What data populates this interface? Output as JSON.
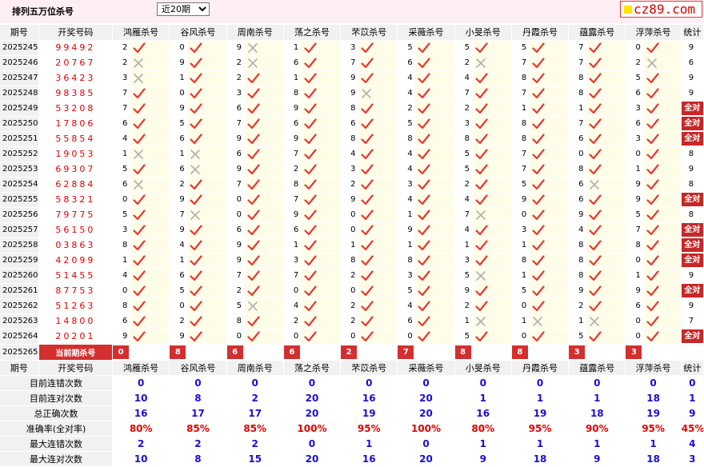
{
  "topbar": {
    "title": "排列五万位杀号",
    "period_select": "近20期",
    "logo": "cz89.com"
  },
  "columns": [
    "期号",
    "开奖号码",
    "鸿雁杀号",
    "谷风杀号",
    "周南杀号",
    "荡之杀号",
    "芣苡杀号",
    "采薇杀号",
    "小旻杀号",
    "丹霞杀号",
    "蕴露杀号",
    "浮萍杀号",
    "统计"
  ],
  "full_label": "全对",
  "rows": [
    {
      "issue": "2025245",
      "numbers": "99492",
      "kills": [
        2,
        0,
        9,
        1,
        3,
        5,
        5,
        5,
        7,
        0
      ],
      "marks": [
        "R",
        "R",
        "W",
        "R",
        "R",
        "R",
        "R",
        "R",
        "R",
        "R"
      ],
      "total": "9"
    },
    {
      "issue": "2025246",
      "numbers": "20767",
      "kills": [
        2,
        9,
        2,
        6,
        7,
        6,
        2,
        7,
        7,
        2
      ],
      "marks": [
        "W",
        "R",
        "W",
        "R",
        "R",
        "R",
        "W",
        "R",
        "R",
        "W"
      ],
      "total": "6"
    },
    {
      "issue": "2025247",
      "numbers": "36423",
      "kills": [
        3,
        1,
        2,
        1,
        9,
        4,
        4,
        8,
        8,
        5
      ],
      "marks": [
        "W",
        "R",
        "R",
        "R",
        "R",
        "R",
        "R",
        "R",
        "R",
        "R"
      ],
      "total": "9"
    },
    {
      "issue": "2025248",
      "numbers": "98385",
      "kills": [
        7,
        0,
        3,
        8,
        9,
        4,
        7,
        7,
        8,
        6
      ],
      "marks": [
        "R",
        "R",
        "R",
        "R",
        "W",
        "R",
        "R",
        "R",
        "R",
        "R"
      ],
      "total": "9"
    },
    {
      "issue": "2025249",
      "numbers": "53208",
      "kills": [
        7,
        9,
        6,
        9,
        8,
        2,
        2,
        1,
        1,
        3
      ],
      "marks": [
        "R",
        "R",
        "R",
        "R",
        "R",
        "R",
        "R",
        "R",
        "R",
        "R"
      ],
      "total": "全对"
    },
    {
      "issue": "2025250",
      "numbers": "17806",
      "kills": [
        6,
        5,
        7,
        6,
        6,
        5,
        3,
        8,
        7,
        6
      ],
      "marks": [
        "R",
        "R",
        "R",
        "R",
        "R",
        "R",
        "R",
        "R",
        "R",
        "R"
      ],
      "total": "全对"
    },
    {
      "issue": "2025251",
      "numbers": "55854",
      "kills": [
        4,
        6,
        9,
        9,
        8,
        8,
        8,
        8,
        6,
        3
      ],
      "marks": [
        "R",
        "R",
        "R",
        "R",
        "R",
        "R",
        "R",
        "R",
        "R",
        "R"
      ],
      "total": "全对"
    },
    {
      "issue": "2025252",
      "numbers": "19053",
      "kills": [
        1,
        1,
        6,
        7,
        4,
        4,
        5,
        7,
        0,
        0
      ],
      "marks": [
        "W",
        "W",
        "R",
        "R",
        "R",
        "R",
        "R",
        "R",
        "R",
        "R"
      ],
      "total": "8"
    },
    {
      "issue": "2025253",
      "numbers": "69307",
      "kills": [
        5,
        6,
        9,
        2,
        3,
        4,
        5,
        7,
        8,
        1
      ],
      "marks": [
        "R",
        "W",
        "R",
        "R",
        "R",
        "R",
        "R",
        "R",
        "R",
        "R"
      ],
      "total": "9"
    },
    {
      "issue": "2025254",
      "numbers": "62884",
      "kills": [
        6,
        2,
        7,
        8,
        2,
        3,
        2,
        5,
        6,
        9
      ],
      "marks": [
        "W",
        "R",
        "R",
        "R",
        "R",
        "R",
        "R",
        "R",
        "W",
        "R"
      ],
      "total": "8"
    },
    {
      "issue": "2025255",
      "numbers": "58321",
      "kills": [
        0,
        9,
        0,
        7,
        9,
        4,
        4,
        9,
        6,
        9
      ],
      "marks": [
        "R",
        "R",
        "R",
        "R",
        "R",
        "R",
        "R",
        "R",
        "R",
        "R"
      ],
      "total": "全对"
    },
    {
      "issue": "2025256",
      "numbers": "79775",
      "kills": [
        5,
        7,
        0,
        9,
        0,
        1,
        7,
        0,
        9,
        5
      ],
      "marks": [
        "R",
        "W",
        "R",
        "R",
        "R",
        "R",
        "W",
        "R",
        "R",
        "R"
      ],
      "total": "8"
    },
    {
      "issue": "2025257",
      "numbers": "56150",
      "kills": [
        3,
        9,
        6,
        6,
        0,
        9,
        4,
        3,
        4,
        7
      ],
      "marks": [
        "R",
        "R",
        "R",
        "R",
        "R",
        "R",
        "R",
        "R",
        "R",
        "R"
      ],
      "total": "全对"
    },
    {
      "issue": "2025258",
      "numbers": "03863",
      "kills": [
        8,
        4,
        9,
        1,
        1,
        1,
        1,
        1,
        8,
        8
      ],
      "marks": [
        "R",
        "R",
        "R",
        "R",
        "R",
        "R",
        "R",
        "R",
        "R",
        "R"
      ],
      "total": "全对"
    },
    {
      "issue": "2025259",
      "numbers": "42099",
      "kills": [
        1,
        1,
        9,
        3,
        8,
        8,
        3,
        8,
        8,
        0
      ],
      "marks": [
        "R",
        "R",
        "R",
        "R",
        "R",
        "R",
        "R",
        "R",
        "R",
        "R"
      ],
      "total": "全对"
    },
    {
      "issue": "2025260",
      "numbers": "51455",
      "kills": [
        4,
        6,
        7,
        7,
        2,
        3,
        5,
        1,
        8,
        1
      ],
      "marks": [
        "R",
        "R",
        "R",
        "R",
        "R",
        "R",
        "W",
        "R",
        "R",
        "R"
      ],
      "total": "9"
    },
    {
      "issue": "2025261",
      "numbers": "87753",
      "kills": [
        0,
        5,
        2,
        0,
        0,
        5,
        9,
        5,
        9,
        9
      ],
      "marks": [
        "R",
        "R",
        "R",
        "R",
        "R",
        "R",
        "R",
        "R",
        "R",
        "R"
      ],
      "total": "全对"
    },
    {
      "issue": "2025262",
      "numbers": "51263",
      "kills": [
        8,
        0,
        5,
        4,
        2,
        4,
        2,
        0,
        2,
        6
      ],
      "marks": [
        "R",
        "R",
        "W",
        "R",
        "R",
        "R",
        "R",
        "R",
        "R",
        "R"
      ],
      "total": "9"
    },
    {
      "issue": "2025263",
      "numbers": "14800",
      "kills": [
        6,
        2,
        8,
        2,
        2,
        6,
        1,
        1,
        1,
        0
      ],
      "marks": [
        "R",
        "R",
        "R",
        "R",
        "R",
        "R",
        "W",
        "W",
        "W",
        "R"
      ],
      "total": "7"
    },
    {
      "issue": "2025264",
      "numbers": "20201",
      "kills": [
        9,
        9,
        0,
        0,
        0,
        0,
        5,
        0,
        5,
        0
      ],
      "marks": [
        "R",
        "R",
        "R",
        "R",
        "R",
        "R",
        "R",
        "R",
        "R",
        "R"
      ],
      "total": "全对"
    }
  ],
  "current": {
    "issue": "2025265",
    "label": "当前期杀号",
    "predictions": [
      "0",
      "8",
      "6",
      "6",
      "2",
      "7",
      "8",
      "8",
      "3",
      "3"
    ]
  },
  "stats": [
    {
      "label": "目前连错次数",
      "values": [
        "0",
        "0",
        "0",
        "0",
        "0",
        "0",
        "0",
        "0",
        "0",
        "0",
        "0"
      ],
      "accent": false
    },
    {
      "label": "目前连对次数",
      "values": [
        "10",
        "8",
        "2",
        "20",
        "16",
        "20",
        "1",
        "1",
        "1",
        "18",
        "1"
      ],
      "accent": false
    },
    {
      "label": "总正确次数",
      "values": [
        "16",
        "17",
        "17",
        "20",
        "19",
        "20",
        "16",
        "19",
        "18",
        "19",
        "9"
      ],
      "accent": false
    },
    {
      "label": "准确率(全对率)",
      "values": [
        "80%",
        "85%",
        "85%",
        "100%",
        "95%",
        "100%",
        "80%",
        "95%",
        "90%",
        "95%",
        "45%"
      ],
      "accent": true
    },
    {
      "label": "最大连错次数",
      "values": [
        "2",
        "2",
        "2",
        "0",
        "1",
        "0",
        "1",
        "1",
        "1",
        "1",
        "4"
      ],
      "accent": false
    },
    {
      "label": "最大连对次数",
      "values": [
        "10",
        "8",
        "15",
        "20",
        "16",
        "20",
        "9",
        "18",
        "9",
        "18",
        "3"
      ],
      "accent": false
    }
  ]
}
